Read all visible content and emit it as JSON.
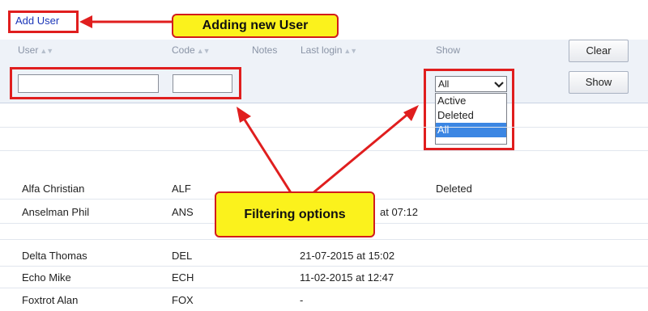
{
  "header": {
    "add_user_label": "Add User"
  },
  "callouts": {
    "add": "Adding new User",
    "filter": "Filtering options"
  },
  "columns": {
    "user": "User",
    "code": "Code",
    "notes": "Notes",
    "last_login": "Last login",
    "show": "Show",
    "sort_glyph": "▲▼"
  },
  "filters": {
    "user_value": "",
    "code_value": ""
  },
  "show_select": {
    "selected": "All",
    "options": [
      "Active",
      "Deleted",
      "All"
    ],
    "highlighted": "All"
  },
  "buttons": {
    "clear": "Clear",
    "show": "Show"
  },
  "rows": [
    {
      "user": "Alfa Christian",
      "code": "ALF",
      "last_login": "",
      "status": "Deleted"
    },
    {
      "user": "Anselman Phil",
      "code": "ANS",
      "last_login": "at 07:12",
      "status": ""
    },
    {
      "user": "Delta Thomas",
      "code": "DEL",
      "last_login": "21-07-2015 at 15:02",
      "status": ""
    },
    {
      "user": "Echo Mike",
      "code": "ECH",
      "last_login": "11-02-2015 at 12:47",
      "status": ""
    },
    {
      "user": "Foxtrot Alan",
      "code": "FOX",
      "last_login": "-",
      "status": ""
    }
  ]
}
